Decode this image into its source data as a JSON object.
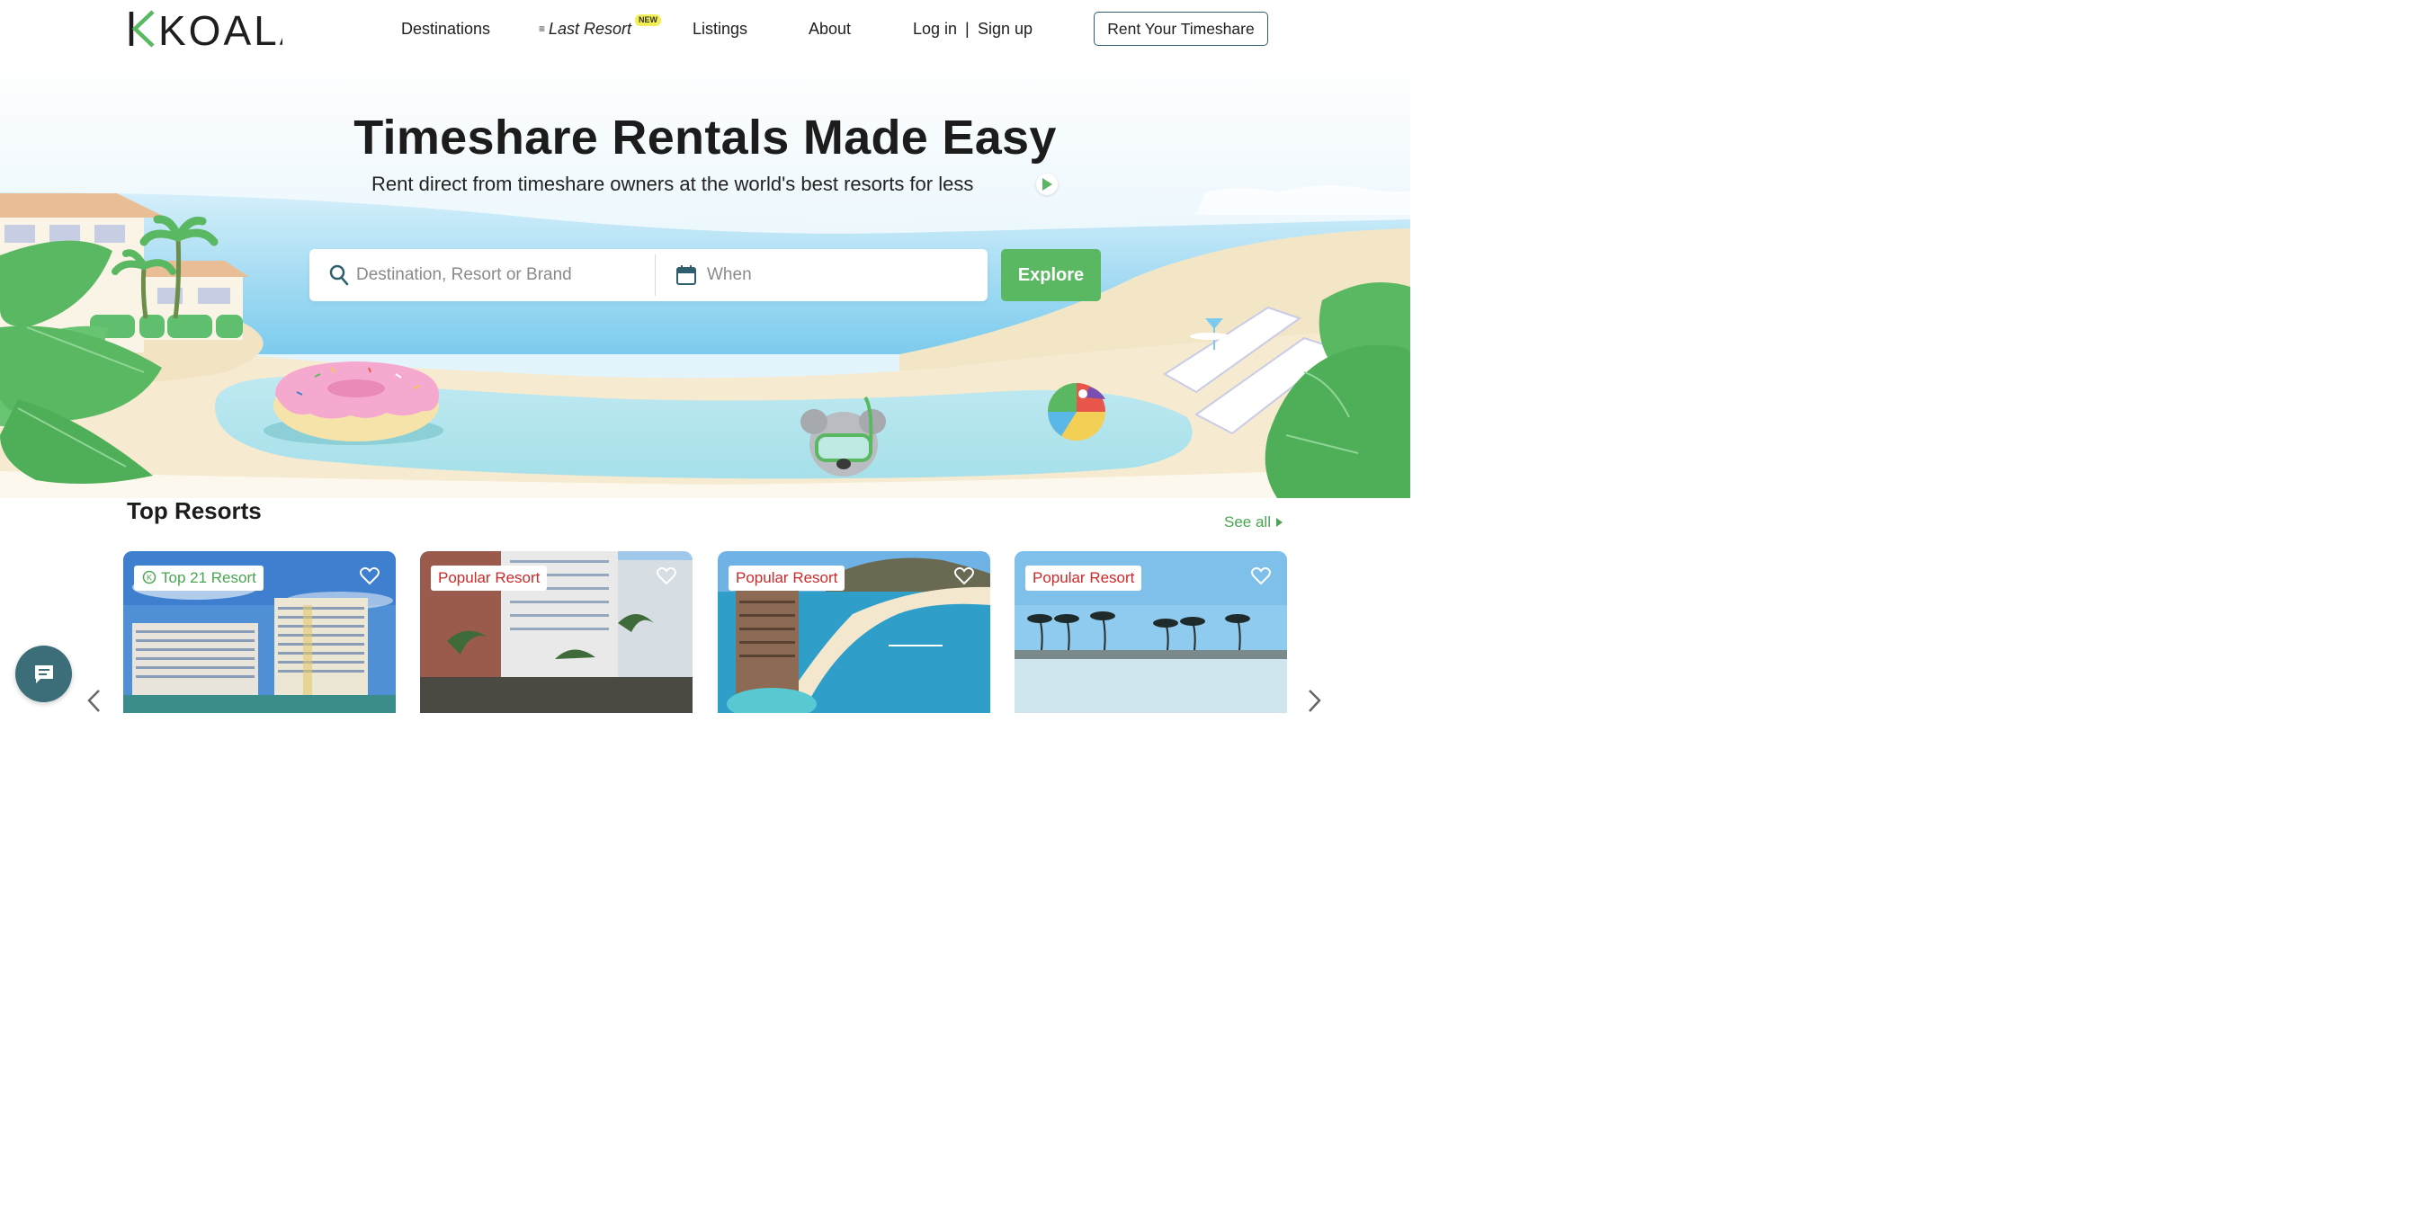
{
  "nav": {
    "logo": "KOALA",
    "links": {
      "destinations": "Destinations",
      "last_resort": "Last Resort",
      "last_resort_badge": "NEW",
      "listings": "Listings",
      "about": "About",
      "login": "Log in",
      "separator": "|",
      "signup": "Sign up"
    },
    "cta": "Rent Your Timeshare"
  },
  "hero": {
    "title": "Timeshare Rentals Made Easy",
    "subtitle": "Rent direct from timeshare owners at the world's best resorts for less",
    "search": {
      "destination_placeholder": "Destination, Resort or Brand",
      "when_placeholder": "When",
      "button": "Explore"
    }
  },
  "top_resorts": {
    "title": "Top Resorts",
    "see_all": "See all",
    "cards": [
      {
        "badge": "Top 21 Resort",
        "badge_style": "green",
        "favorited": false
      },
      {
        "badge": "Popular Resort",
        "badge_style": "red",
        "favorited": false
      },
      {
        "badge": "Popular Resort",
        "badge_style": "red",
        "favorited": false
      },
      {
        "badge": "Popular Resort",
        "badge_style": "red",
        "favorited": false
      }
    ]
  },
  "colors": {
    "brand_green": "#5bb862",
    "teal": "#3c6e7a",
    "badge_red": "#cc2a2a",
    "new_badge": "#f1ef54"
  },
  "icons": {
    "search": "search-icon",
    "calendar": "calendar-icon",
    "heart": "heart-icon",
    "chat": "chat-icon",
    "play": "play-icon"
  }
}
